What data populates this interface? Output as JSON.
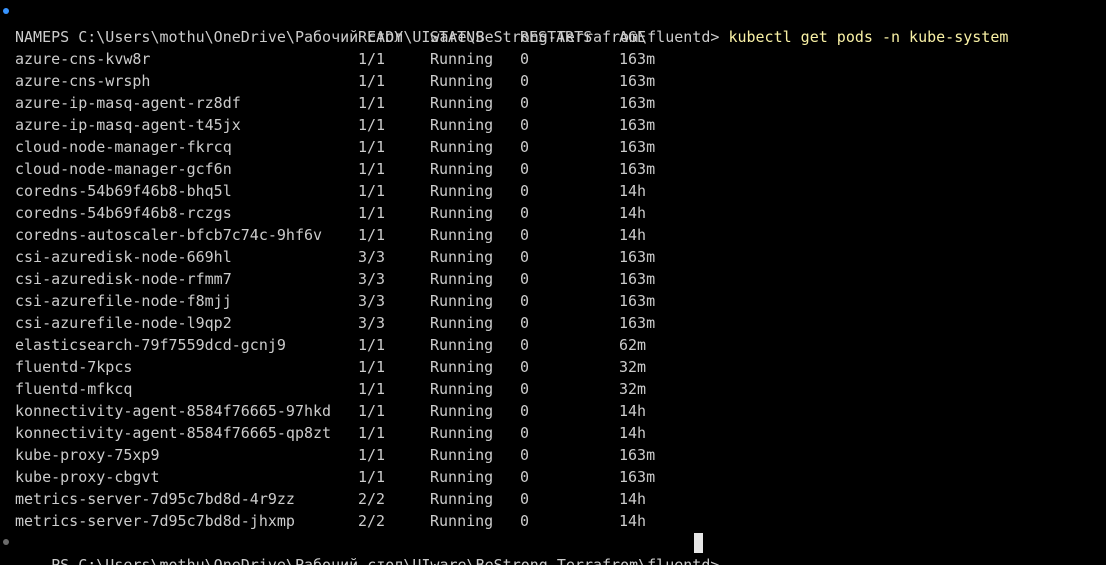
{
  "prompt_text": "PS C:\\Users\\mothu\\OneDrive\\Рабочий стол\\UIware\\BeStrong-Terrafrom\\fluentd> ",
  "command_text": "kubectl get pods -n kube-system",
  "table": {
    "headers": [
      "NAME",
      "READY",
      "STATUS",
      "RESTARTS",
      "AGE"
    ],
    "rows": [
      [
        "azure-cns-kvw8r",
        "1/1",
        "Running",
        "0",
        "163m"
      ],
      [
        "azure-cns-wrsph",
        "1/1",
        "Running",
        "0",
        "163m"
      ],
      [
        "azure-ip-masq-agent-rz8df",
        "1/1",
        "Running",
        "0",
        "163m"
      ],
      [
        "azure-ip-masq-agent-t45jx",
        "1/1",
        "Running",
        "0",
        "163m"
      ],
      [
        "cloud-node-manager-fkrcq",
        "1/1",
        "Running",
        "0",
        "163m"
      ],
      [
        "cloud-node-manager-gcf6n",
        "1/1",
        "Running",
        "0",
        "163m"
      ],
      [
        "coredns-54b69f46b8-bhq5l",
        "1/1",
        "Running",
        "0",
        "14h"
      ],
      [
        "coredns-54b69f46b8-rczgs",
        "1/1",
        "Running",
        "0",
        "14h"
      ],
      [
        "coredns-autoscaler-bfcb7c74c-9hf6v",
        "1/1",
        "Running",
        "0",
        "14h"
      ],
      [
        "csi-azuredisk-node-669hl",
        "3/3",
        "Running",
        "0",
        "163m"
      ],
      [
        "csi-azuredisk-node-rfmm7",
        "3/3",
        "Running",
        "0",
        "163m"
      ],
      [
        "csi-azurefile-node-f8mjj",
        "3/3",
        "Running",
        "0",
        "163m"
      ],
      [
        "csi-azurefile-node-l9qp2",
        "3/3",
        "Running",
        "0",
        "163m"
      ],
      [
        "elasticsearch-79f7559dcd-gcnj9",
        "1/1",
        "Running",
        "0",
        "62m"
      ],
      [
        "fluentd-7kpcs",
        "1/1",
        "Running",
        "0",
        "32m"
      ],
      [
        "fluentd-mfkcq",
        "1/1",
        "Running",
        "0",
        "32m"
      ],
      [
        "konnectivity-agent-8584f76665-97hkd",
        "1/1",
        "Running",
        "0",
        "14h"
      ],
      [
        "konnectivity-agent-8584f76665-qp8zt",
        "1/1",
        "Running",
        "0",
        "14h"
      ],
      [
        "kube-proxy-75xp9",
        "1/1",
        "Running",
        "0",
        "163m"
      ],
      [
        "kube-proxy-cbgvt",
        "1/1",
        "Running",
        "0",
        "163m"
      ],
      [
        "metrics-server-7d95c7bd8d-4r9zz",
        "2/2",
        "Running",
        "0",
        "14h"
      ],
      [
        "metrics-server-7d95c7bd8d-jhxmp",
        "2/2",
        "Running",
        "0",
        "14h"
      ]
    ]
  },
  "final_prompt_text": "PS C:\\Users\\mothu\\OneDrive\\Рабочий стол\\UIware\\BeStrong-Terrafrom\\fluentd> ",
  "colors": {
    "background": "#000000",
    "text": "#cccccc",
    "command": "#f9f1a5",
    "marker_success": "#3794ff",
    "marker_pending": "#6b6b6b",
    "cursor": "#e6e6e6"
  },
  "icons": {
    "command_marker": "decoration-dot-icon",
    "prompt_marker": "decoration-dot-icon",
    "cursor": "block-cursor-icon"
  }
}
